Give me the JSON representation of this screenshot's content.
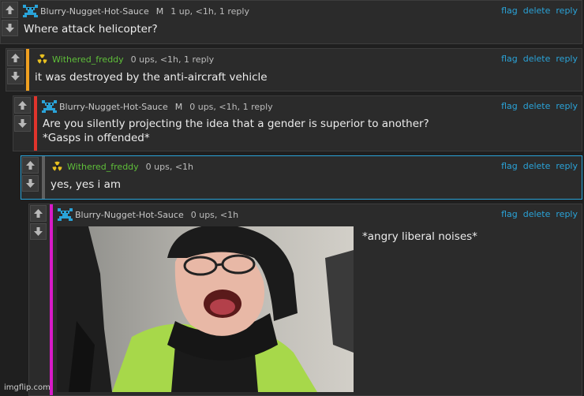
{
  "colors": {
    "link": "#2aa3d8",
    "rail_orange": "#f0a020",
    "rail_red": "#e0342c",
    "rail_gray": "#606060",
    "rail_magenta": "#d81ac8",
    "green_user": "#5fbf3a"
  },
  "actions": {
    "flag": "flag",
    "delete": "delete",
    "reply": "reply"
  },
  "comments": [
    {
      "username": "Blurry-Nugget-Hot-Sauce",
      "mod": "M",
      "meta": "1 up, <1h, 1 reply",
      "avatar_icon": "blue-blocky-avatar-icon",
      "lines": [
        "Where attack helicopter?"
      ]
    },
    {
      "username": "Withered_freddy",
      "meta": "0 ups, <1h, 1 reply",
      "avatar_icon": "radiation-symbol-avatar-icon",
      "lines": [
        "it was destroyed by the anti-aircraft vehicle"
      ]
    },
    {
      "username": "Blurry-Nugget-Hot-Sauce",
      "mod": "M",
      "meta": "0 ups, <1h, 1 reply",
      "avatar_icon": "blue-blocky-avatar-icon",
      "lines": [
        "Are you silently projecting the idea that a gender is superior to another?",
        "*Gasps in offended*"
      ]
    },
    {
      "username": "Withered_freddy",
      "meta": "0 ups, <1h",
      "avatar_icon": "radiation-symbol-avatar-icon",
      "lines": [
        "yes, yes i am"
      ]
    },
    {
      "username": "Blurry-Nugget-Hot-Sauce",
      "meta": "0 ups, <1h",
      "avatar_icon": "blue-blocky-avatar-icon",
      "lines": [
        "*angry liberal noises*"
      ],
      "image_icon": "screaming-protester-photo"
    }
  ],
  "watermark": "imgflip.com"
}
